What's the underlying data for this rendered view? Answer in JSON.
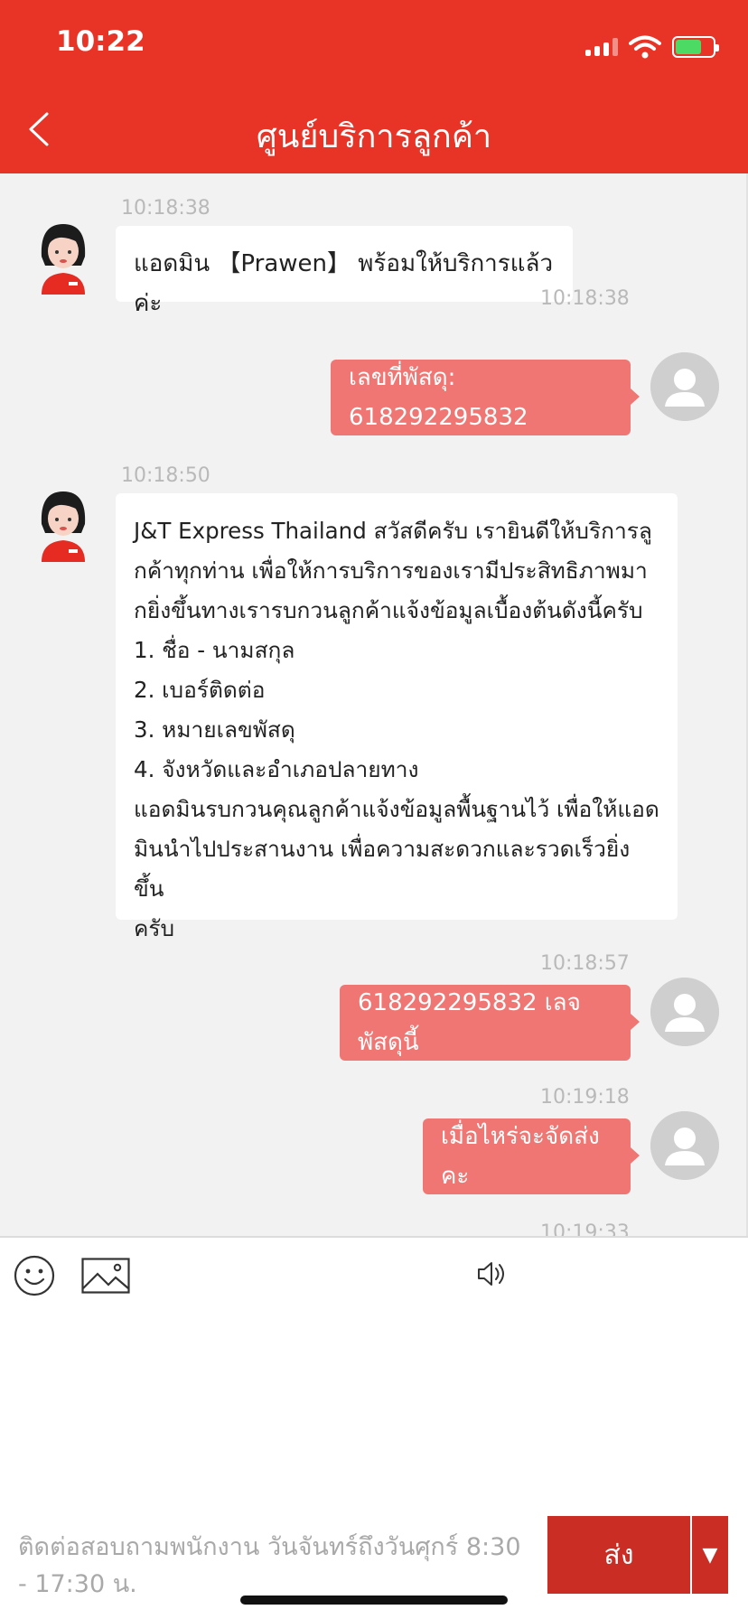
{
  "status_bar": {
    "time": "10:22"
  },
  "header": {
    "title": "ศูนย์บริการลูกค้า"
  },
  "messages": [
    {
      "from": "agent",
      "time": "10:18:38",
      "text": "แอดมิน 【Prawen】 พร้อมให้บริการแล้วค่ะ"
    },
    {
      "from": "user",
      "time": "10:18:38",
      "text": "เลขที่พัสดุ: 618292295832"
    },
    {
      "from": "agent",
      "time": "10:18:50",
      "text": "J&T Express Thailand สวัสดีครับ เรายินดีให้บริการลู\nกค้าทุกท่าน เพื่อให้การบริการของเรามีประสิทธิภาพมา\nกยิ่งขึ้นทางเรารบกวนลูกค้าแจ้งข้อมูลเบื้องต้นดังนี้ครับ\n1. ชื่อ - นามสกุล\n2. เบอร์ติดต่อ\n3. หมายเลขพัสดุ\n4. จังหวัดและอำเภอปลายทาง\nแอดมินรบกวนคุณลูกค้าแจ้งข้อมูลพื้นฐานไว้ เพื่อให้แอด\nมินนำไปประสานงาน เพื่อความสะดวกและรวดเร็วยิ่งขึ้น\nครับ"
    },
    {
      "from": "user",
      "time": "10:18:57",
      "text": "618292295832 เลจพัสดุนี้"
    },
    {
      "from": "user",
      "time": "10:19:18",
      "text": "เมื่อไหร่จะจัดส่งคะ"
    },
    {
      "from": "user",
      "time": "10:19:33",
      "text": ""
    }
  ],
  "composer": {
    "notice": "ติดต่อสอบถามพนักงาน วันจันทร์ถึงวันศุกร์ 8:30 - 17:30 น.",
    "send_label": "ส่ง",
    "dropdown_icon": "▼"
  },
  "colors": {
    "header": "#e83427",
    "user_bubble": "#ef7672",
    "send_button": "#c92d24"
  }
}
